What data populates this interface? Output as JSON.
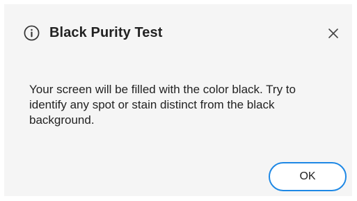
{
  "dialog": {
    "title": "Black Purity Test",
    "title_icon": "info-icon",
    "close_icon": "close-icon",
    "message": "Your screen will be filled with the color black. Try to identify any spot or stain distinct from the black background.",
    "ok_label": "OK",
    "accent_color": "#1e88e5",
    "background_color": "#f5f5f5"
  }
}
